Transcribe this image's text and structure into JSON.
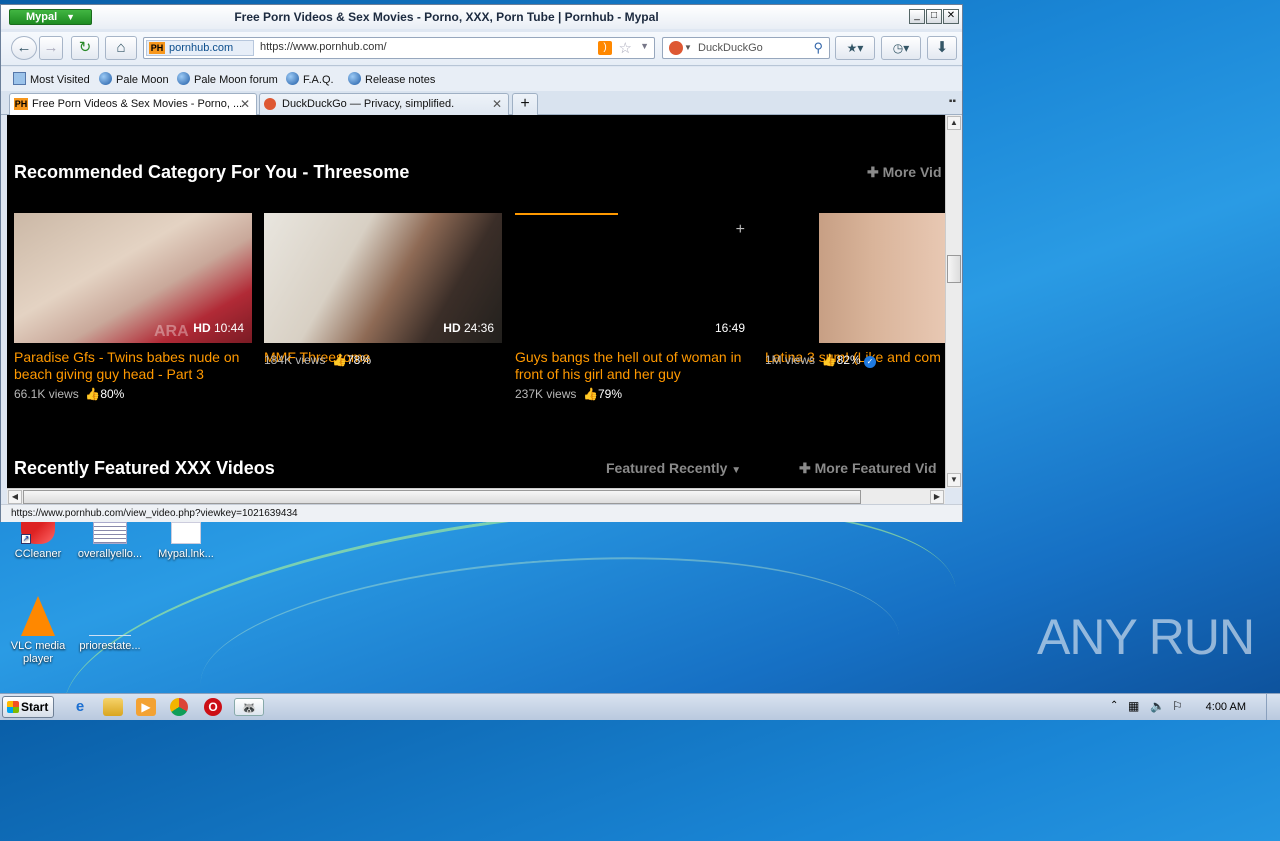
{
  "window": {
    "app_menu_label": "Mypal",
    "title": "Free Porn Videos & Sex Movies - Porno, XXX, Porn Tube | Pornhub - Mypal"
  },
  "navbar": {
    "site_identity": "pornhub.com",
    "url": "https://www.pornhub.com/",
    "search_placeholder": "DuckDuckGo"
  },
  "bookmarks": [
    "Most Visited",
    "Pale Moon",
    "Pale Moon forum",
    "F.A.Q.",
    "Release notes"
  ],
  "tabs": [
    {
      "label": "Free Porn Videos & Sex Movies - Porno, ..."
    },
    {
      "label": "DuckDuckGo — Privacy, simplified."
    }
  ],
  "page": {
    "section1_title": "Recommended Category For You - Threesome",
    "section1_more": "More Vid",
    "section2_title": "Recently Featured XXX Videos",
    "section2_filter": "Featured Recently",
    "section2_more": "More Featured Vid",
    "videos": [
      {
        "title_line1": "Paradise Gfs - Twins babes nude on",
        "title_line2": "beach giving guy head - Part 3",
        "hd": "HD",
        "duration": "10:44",
        "views": "66.1K views",
        "rating": "80%",
        "verified": false,
        "overlay": "ARA"
      },
      {
        "title_line1": "MMF Threesome",
        "title_line2": "",
        "hd": "HD",
        "duration": "24:36",
        "views": "184K views",
        "rating": "78%",
        "verified": false,
        "overlay": ""
      },
      {
        "title_line1": "Guys bangs the hell out of woman in",
        "title_line2": "front of his girl and her guy",
        "hd": "",
        "duration": "16:49",
        "views": "237K views",
        "rating": "79%",
        "verified": false,
        "overlay": ""
      },
      {
        "title_line1": "Latina 3 sum! (Like and com",
        "title_line2": "",
        "hd": "",
        "duration": "",
        "views": "1M views",
        "rating": "82%",
        "verified": true,
        "overlay": ""
      }
    ]
  },
  "status_url": "https://www.pornhub.com/view_video.php?viewkey=1021639434",
  "desktop_icons": [
    "CCleaner",
    "overallyello...",
    "Mypal.lnk...",
    "VLC media player",
    "priorestate..."
  ],
  "taskbar": {
    "start_label": "Start",
    "clock": "4:00 AM"
  },
  "watermark": "ANY RUN",
  "colors": {
    "accent_orange": "#ff9900",
    "mypal_green": "#2a9e2c"
  }
}
